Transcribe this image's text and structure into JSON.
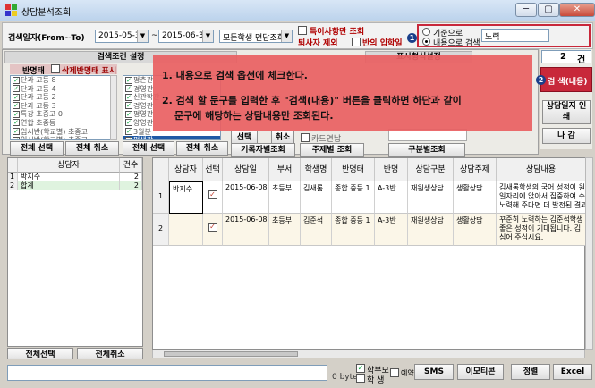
{
  "window": {
    "title": "상담분석조회",
    "buttons": {
      "minimize": "─",
      "maximize": "▢",
      "close": "✕"
    }
  },
  "search": {
    "date_label": "검색일자(From~To)",
    "date_from": "2015-05-30",
    "date_sep": "~",
    "date_to": "2015-06-30",
    "view_select": "모든학생 면담조회",
    "check_special": "특이사항만 조회",
    "check_exclude_withdrawn": "퇴사자 제외",
    "check_class_enroll": "반의 입학일",
    "radio_basic": "기준으로",
    "radio_content": "내용으로 검색",
    "content_value": "노력",
    "count": "2",
    "count_unit": "건"
  },
  "conditions": {
    "title": "검색조건 설정",
    "title_right": "표시형식설정",
    "class_label": "반명태",
    "show_deleted": "삭제반명태 표시",
    "class_items": [
      "단과 고등 8",
      "단과 고등 4",
      "단과 고등 2",
      "단과 고등 3",
      "특강 초중고 0",
      "연합 초중등",
      "임시반(학교별) 초중고",
      "임시반(학교별) 초중고"
    ],
    "teacher_items": [
      "평촌관",
      "경영관",
      "신관학관",
      "경영관",
      "평영관",
      "양영관",
      "3월분",
      "평생관"
    ],
    "buttons": {
      "select_all_1": "전체 선택",
      "cancel_all_1": "전체 취소",
      "select_all_2": "전체 선택",
      "cancel_all_2": "전체 취소",
      "select_3": "선택",
      "cancel_3": "취소",
      "by_register": "기록자별조회",
      "by_subject": "주제별 조회",
      "by_category": "구분별조회"
    },
    "card_check": "카드연납"
  },
  "overlay": {
    "line1": "1. 내용으로 검색 옵션에 체크한다.",
    "line2": "2. 검색 할 문구를 입력한 후 \"검색(내용)\" 버튼을 클릭하면 하단과 같이",
    "line3": "문구에 해당하는 상담내용만 조회된다."
  },
  "right_panel": {
    "search_content": "검 색(내용)",
    "counsel_print": "상담일지 인 쇄",
    "exit": "나 감"
  },
  "counselor_table": {
    "headers": [
      "상담자",
      "건수"
    ],
    "rows": [
      {
        "no": "1",
        "name": "박지수",
        "count": "2"
      },
      {
        "no": "2",
        "name": "합계",
        "count": "2"
      }
    ],
    "select_all": "전체선택",
    "cancel_all": "전체취소"
  },
  "detail_table": {
    "headers": [
      "상담자",
      "선택",
      "상담일",
      "부서",
      "학생명",
      "반명태",
      "반명",
      "상담구분",
      "상담주제",
      "상담내용"
    ],
    "rows": [
      {
        "no": "1",
        "counselor": "박지수",
        "date": "2015-06-08",
        "dept": "초등부",
        "student": "김새롬",
        "class_type": "종합 중등 1",
        "class": "A-3반",
        "category": "재원생상담",
        "topic": "생활상담",
        "content": [
          "김새롬학생의 국어 성적이 원",
          "일자리에 앉아서 집중하여 수",
          "노력해 주다면 더 발전된 결과"
        ]
      },
      {
        "no": "2",
        "counselor": "",
        "date": "2015-06-08",
        "dept": "초등부",
        "student": "김준석",
        "class_type": "종합 중등 1",
        "class": "A-3반",
        "category": "재원생상담",
        "topic": "생활상담",
        "content": [
          "꾸준히 노력하는 김준석학생",
          "좋은 성적이 기대됩니다. 김",
          "심어 주십시요."
        ]
      }
    ]
  },
  "bottom": {
    "byte_count": "0 byte",
    "check_parent": "학부모",
    "check_student": "학 생",
    "check_reserve": "예약",
    "sms": "SMS",
    "emoticon": "이모티콘",
    "sort": "정렬",
    "excel": "Excel"
  },
  "colors": {
    "overlay": "#e95f62",
    "accent_blue": "#1a3f8a",
    "row_select": "#1f5aa6"
  }
}
